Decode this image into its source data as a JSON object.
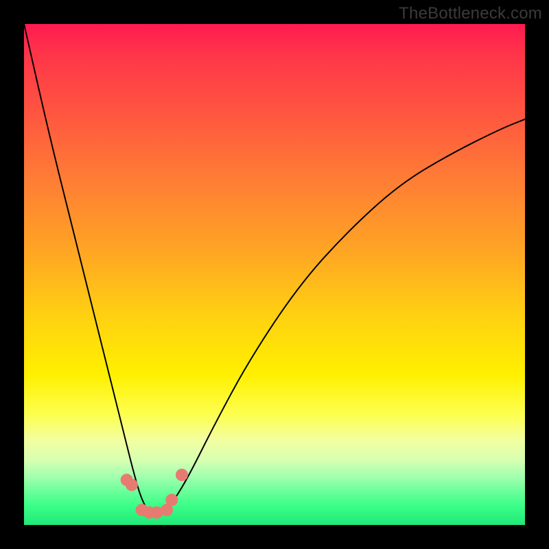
{
  "watermark": {
    "text": "TheBottleneck.com"
  },
  "chart_data": {
    "type": "line",
    "title": "",
    "xlabel": "",
    "ylabel": "",
    "xlim": [
      0,
      100
    ],
    "ylim": [
      0,
      100
    ],
    "grid": false,
    "legend": false,
    "annotations": [],
    "series": [
      {
        "name": "curve",
        "x": [
          0,
          5,
          10,
          14,
          17,
          20,
          22,
          23.5,
          25,
          26.5,
          28,
          30,
          33,
          38,
          45,
          55,
          65,
          75,
          85,
          95,
          100
        ],
        "values": [
          100,
          78,
          58,
          42,
          30,
          18,
          10,
          5,
          2.5,
          2,
          2.5,
          5,
          10,
          20,
          33,
          48,
          59,
          68,
          74,
          79,
          81
        ]
      },
      {
        "name": "markers",
        "x": [
          20.5,
          21.5,
          23.5,
          25,
          26.5,
          28.5,
          29.5,
          31.5
        ],
        "values": [
          9,
          8,
          3,
          2.5,
          2.5,
          3,
          5,
          10
        ]
      }
    ],
    "gradient_stops": [
      {
        "pos_pct": 0,
        "color": "#ff1a52"
      },
      {
        "pos_pct": 18,
        "color": "#ff5640"
      },
      {
        "pos_pct": 45,
        "color": "#ffa424"
      },
      {
        "pos_pct": 70,
        "color": "#fff000"
      },
      {
        "pos_pct": 90,
        "color": "#a8ffb0"
      },
      {
        "pos_pct": 100,
        "color": "#20e878"
      }
    ]
  }
}
